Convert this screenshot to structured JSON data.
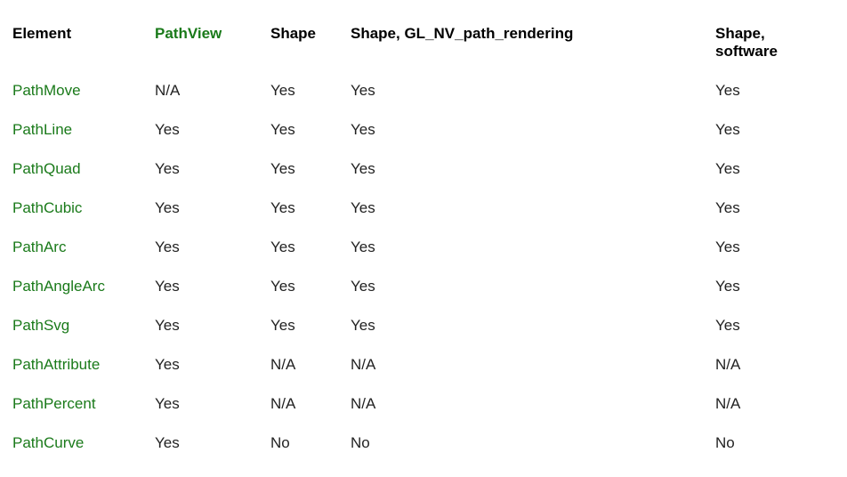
{
  "table": {
    "headers": {
      "element": "Element",
      "pathview": "PathView",
      "shape": "Shape",
      "shape_gl": "Shape, GL_NV_path_rendering",
      "shape_sw": "Shape, software"
    },
    "rows": [
      {
        "element": "PathMove",
        "pathview": "N/A",
        "shape": "Yes",
        "shape_gl": "Yes",
        "shape_sw": "Yes"
      },
      {
        "element": "PathLine",
        "pathview": "Yes",
        "shape": "Yes",
        "shape_gl": "Yes",
        "shape_sw": "Yes"
      },
      {
        "element": "PathQuad",
        "pathview": "Yes",
        "shape": "Yes",
        "shape_gl": "Yes",
        "shape_sw": "Yes"
      },
      {
        "element": "PathCubic",
        "pathview": "Yes",
        "shape": "Yes",
        "shape_gl": "Yes",
        "shape_sw": "Yes"
      },
      {
        "element": "PathArc",
        "pathview": "Yes",
        "shape": "Yes",
        "shape_gl": "Yes",
        "shape_sw": "Yes"
      },
      {
        "element": "PathAngleArc",
        "pathview": "Yes",
        "shape": "Yes",
        "shape_gl": "Yes",
        "shape_sw": "Yes"
      },
      {
        "element": "PathSvg",
        "pathview": "Yes",
        "shape": "Yes",
        "shape_gl": "Yes",
        "shape_sw": "Yes"
      },
      {
        "element": "PathAttribute",
        "pathview": "Yes",
        "shape": "N/A",
        "shape_gl": "N/A",
        "shape_sw": "N/A"
      },
      {
        "element": "PathPercent",
        "pathview": "Yes",
        "shape": "N/A",
        "shape_gl": "N/A",
        "shape_sw": "N/A"
      },
      {
        "element": "PathCurve",
        "pathview": "Yes",
        "shape": "No",
        "shape_gl": "No",
        "shape_sw": "No"
      }
    ]
  }
}
